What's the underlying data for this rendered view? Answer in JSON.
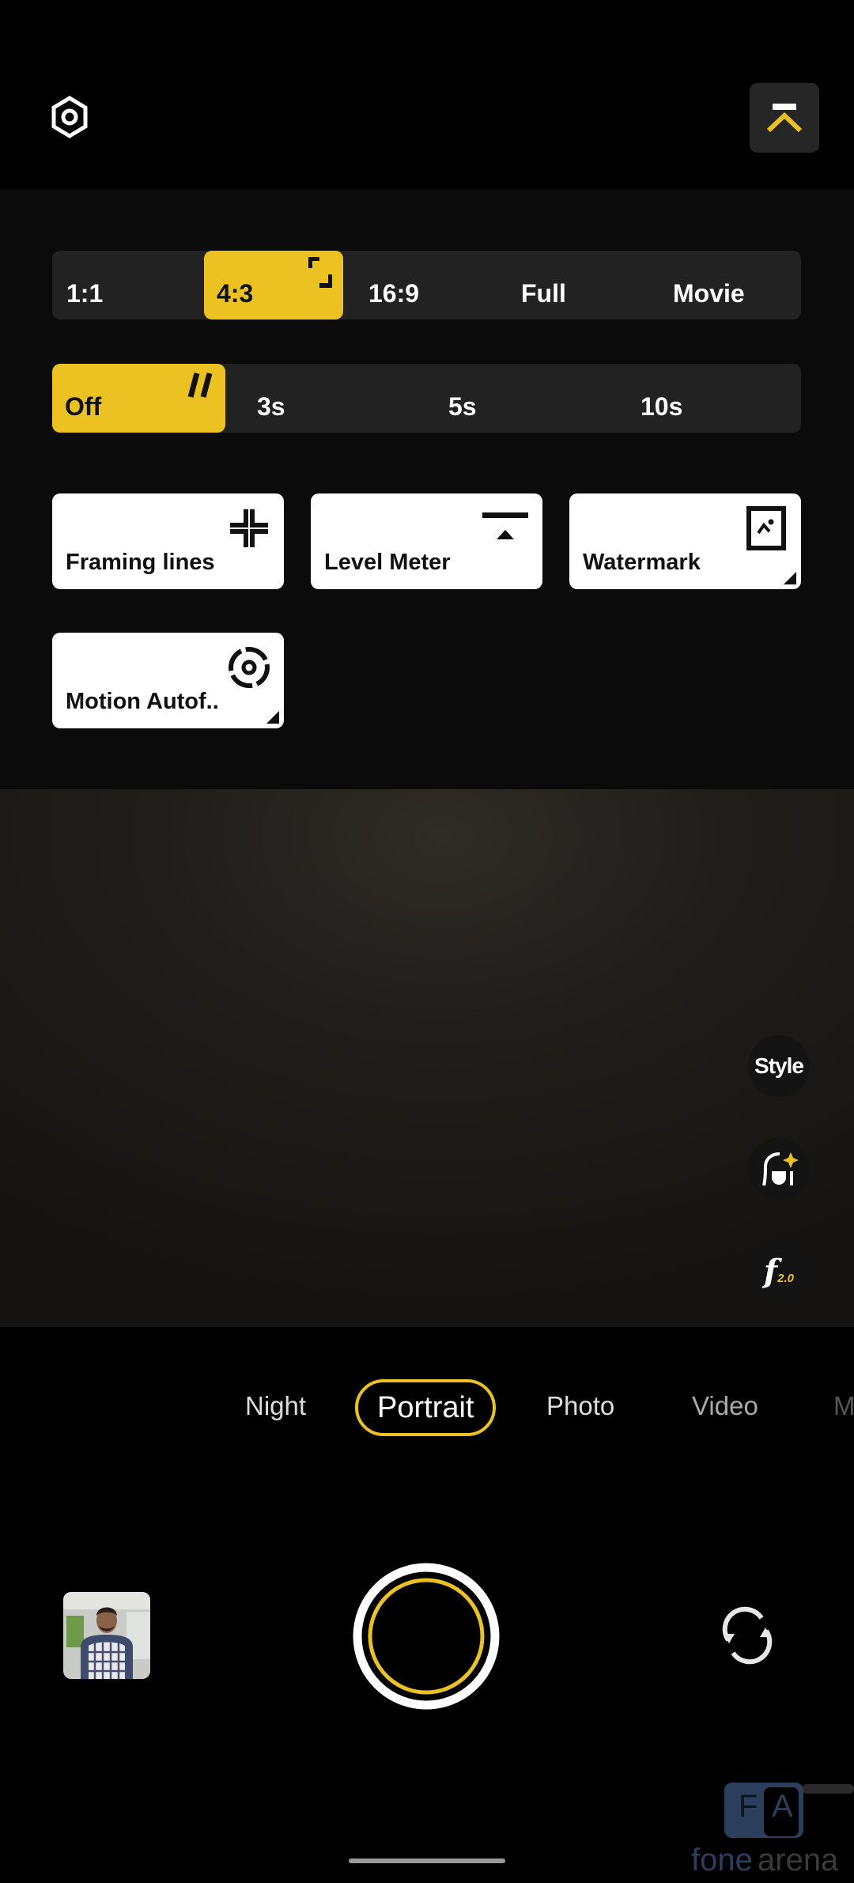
{
  "top_bar": {
    "settings_icon": "gear-hexagon-icon",
    "collapse_icon": "collapse-up-icon"
  },
  "aspect_ratio": {
    "options": [
      "1:1",
      "4:3",
      "16:9",
      "Full",
      "Movie"
    ],
    "selected": "4:3",
    "selected_icon": "corner-bracket-icon"
  },
  "timer": {
    "options": [
      "Off",
      "3s",
      "5s",
      "10s"
    ],
    "selected": "Off",
    "selected_icon": "timer-off-slashes-icon"
  },
  "quick_tiles": [
    {
      "label": "Framing lines",
      "icon": "framing-lines-icon",
      "has_submenu": false
    },
    {
      "label": "Level Meter",
      "icon": "level-meter-icon",
      "has_submenu": false
    },
    {
      "label": "Watermark",
      "icon": "watermark-icon",
      "has_submenu": true
    },
    {
      "label": "Motion Autof..",
      "icon": "motion-autofocus-icon",
      "has_submenu": true
    }
  ],
  "side_buttons": {
    "style_label": "Style",
    "beauty_icon": "portrait-beauty-icon",
    "aperture_label": "f",
    "aperture_value": "2.0"
  },
  "modes": {
    "items": [
      "Night",
      "Portrait",
      "Photo",
      "Video",
      "M"
    ],
    "selected": "Portrait"
  },
  "bottom": {
    "gallery_icon": "gallery-thumbnail",
    "shutter_icon": "shutter-button",
    "flip_icon": "flip-camera-icon"
  },
  "watermark": {
    "logo_letters": [
      "F",
      "A"
    ],
    "brand_part1": "fone",
    "brand_part2": "arena"
  },
  "colors": {
    "accent": "#ebc222",
    "panel": "#222222",
    "background": "#000000"
  }
}
